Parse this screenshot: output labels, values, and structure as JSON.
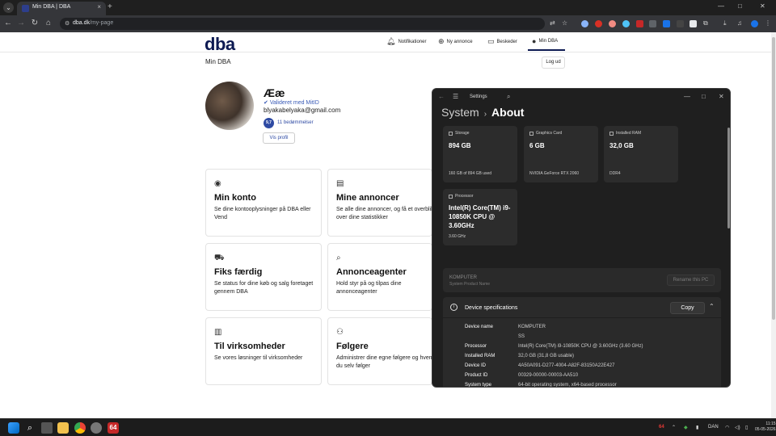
{
  "browser": {
    "tab_title": "Min DBA | DBA",
    "tab_close": "×",
    "new_tab": "+",
    "url_domain": "dba.dk",
    "url_path": "/my-page",
    "win_min": "—",
    "win_max": "□",
    "win_close": "✕"
  },
  "site": {
    "logo": "dba",
    "nav": {
      "notifications": "Notifikationer",
      "new_ad": "Ny annonce",
      "messages": "Beskeder",
      "my_dba": "Min DBA"
    },
    "breadcrumb": "Min DBA",
    "logout": "Log ud",
    "profile": {
      "name": "Ææ",
      "verified": "Valideret med MitID",
      "email": "blyakabelyaka@gmail.com",
      "rating": "9,7",
      "reviews": "11 bedømmelser",
      "view_profile": "Vis profil"
    },
    "cards": [
      {
        "title": "Min konto",
        "desc": "Se dine kontooplysninger på DBA eller Vend"
      },
      {
        "title": "Mine annoncer",
        "desc": "Se alle dine annoncer, og få et overblik over dine statistikker"
      },
      {
        "title": "Fiks færdig",
        "desc": "Se status for dine køb og salg foretaget gennem DBA"
      },
      {
        "title": "Annonceagenter",
        "desc": "Hold styr på og tilpas dine annonceagenter"
      },
      {
        "title": "Til virksomheder",
        "desc": "Se vores løsninger til virksomheder"
      },
      {
        "title": "Følgere",
        "desc": "Administrer dine egne følgere og hvem du selv følger"
      }
    ]
  },
  "settings": {
    "window_title": "Settings",
    "breadcrumb_parent": "System",
    "breadcrumb_sep": "›",
    "breadcrumb_current": "About",
    "tiles": [
      {
        "label": "Storage",
        "value": "894 GB",
        "sub": "160 GB of 894 GB used"
      },
      {
        "label": "Graphics Card",
        "value": "6 GB",
        "sub": "NVIDIA GeForce RTX 2060"
      },
      {
        "label": "Installed RAM",
        "value": "32,0 GB",
        "sub": "DDR4"
      },
      {
        "label": "Processor",
        "value": "Intel(R) Core(TM) i9-10850K CPU @ 3.60GHz",
        "sub": "3.60 GHz"
      }
    ],
    "pc_name": "KOMPUTER",
    "pc_sub": "System Product Name",
    "rename_btn": "Rename this PC",
    "specs_title": "Device specifications",
    "copy_btn": "Copy",
    "specs": [
      {
        "k": "Device name",
        "v": "KOMPUTER"
      },
      {
        "k": "",
        "v": "SS"
      },
      {
        "k": "Processor",
        "v": "Intel(R) Core(TM) i9-10850K CPU @ 3.60GHz (3.60 GHz)"
      },
      {
        "k": "Installed RAM",
        "v": "32,0 GB (31,8 GB usable)"
      },
      {
        "k": "Device ID",
        "v": "4A50A091-D277-4004-A82F-83150A22E427"
      },
      {
        "k": "Product ID",
        "v": "00329-00000-00003-AA510"
      },
      {
        "k": "System type",
        "v": "64-bit operating system, x64-based processor"
      }
    ]
  },
  "taskbar": {
    "badge": "64",
    "language": "DAN",
    "time": "11:15",
    "date": "05-05-2026"
  },
  "colors": {
    "brand": "#0d1a52",
    "link": "#2e4aa3"
  }
}
